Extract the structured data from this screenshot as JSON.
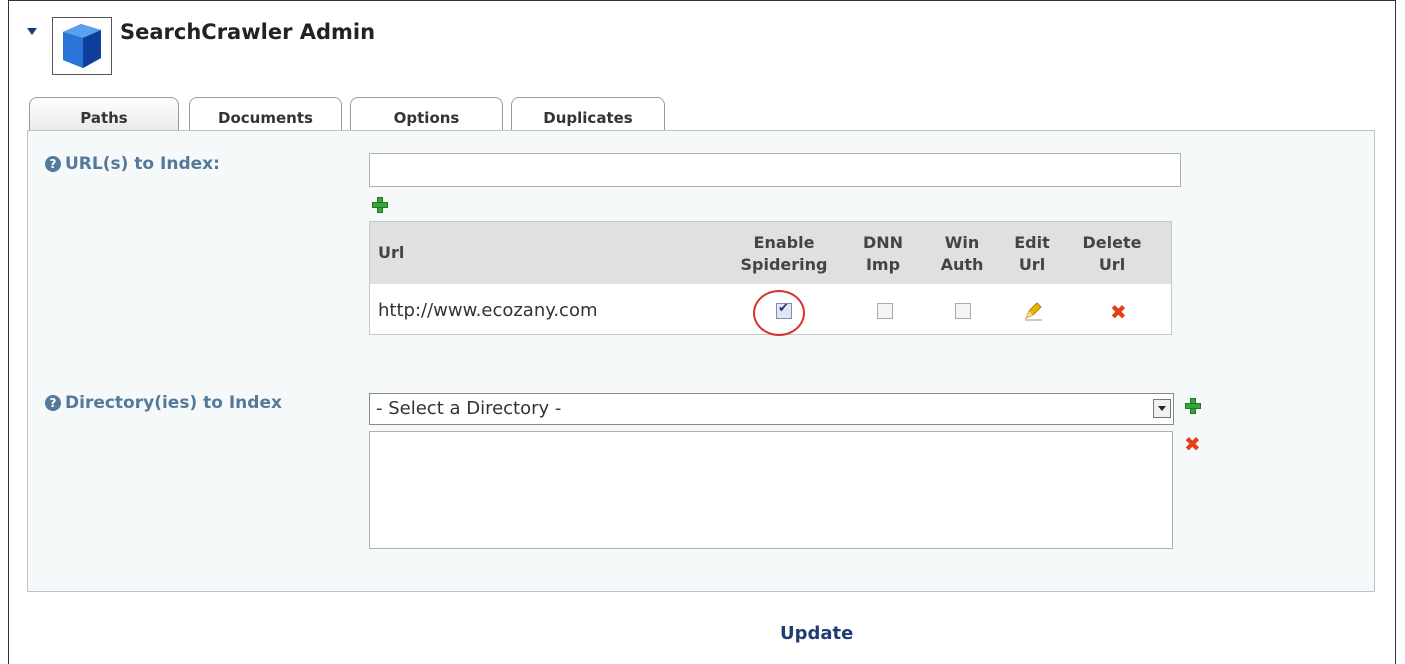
{
  "module": {
    "title": "SearchCrawler Admin",
    "icon": "cube-icon"
  },
  "tabs": [
    {
      "label": "Paths",
      "active": true
    },
    {
      "label": "Documents",
      "active": false
    },
    {
      "label": "Options",
      "active": false
    },
    {
      "label": "Duplicates",
      "active": false
    }
  ],
  "urls": {
    "label": "URL(s) to Index:",
    "input_value": "",
    "columns": [
      "Url",
      "Enable Spidering",
      "DNN Imp",
      "Win Auth",
      "Edit Url",
      "Delete Url"
    ],
    "columns_lines": [
      [
        "Url"
      ],
      [
        "Enable",
        "Spidering"
      ],
      [
        "DNN",
        "Imp"
      ],
      [
        "Win",
        "Auth"
      ],
      [
        "Edit",
        "Url"
      ],
      [
        "Delete",
        "Url"
      ]
    ],
    "rows": [
      {
        "url": "http://www.ecozany.com",
        "enable_spidering": true,
        "dnn_imp": false,
        "win_auth": false
      }
    ]
  },
  "directories": {
    "label": "Directory(ies) to Index",
    "selected": "- Select a Directory -",
    "items": []
  },
  "update_label": "Update",
  "colors": {
    "label": "#54799a",
    "link": "#1f3c73",
    "highlight": "#d8302c"
  }
}
